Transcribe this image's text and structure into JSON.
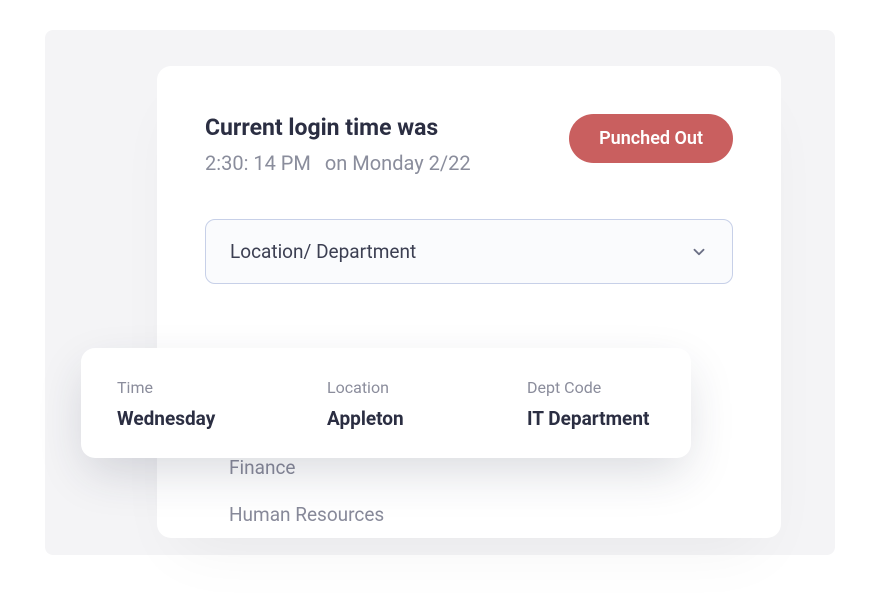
{
  "header": {
    "title": "Current login time was",
    "time": "2:30: 14 PM",
    "date_prefix": "on Monday 2/22",
    "status_label": "Punched Out"
  },
  "dropdown": {
    "label": "Location/ Department"
  },
  "options": [
    "Finance",
    "Human Resources"
  ],
  "popover": {
    "cols": [
      {
        "label": "Time",
        "value": "Wednesday"
      },
      {
        "label": "Location",
        "value": "Appleton"
      },
      {
        "label": "Dept Code",
        "value": "IT Department"
      }
    ]
  }
}
